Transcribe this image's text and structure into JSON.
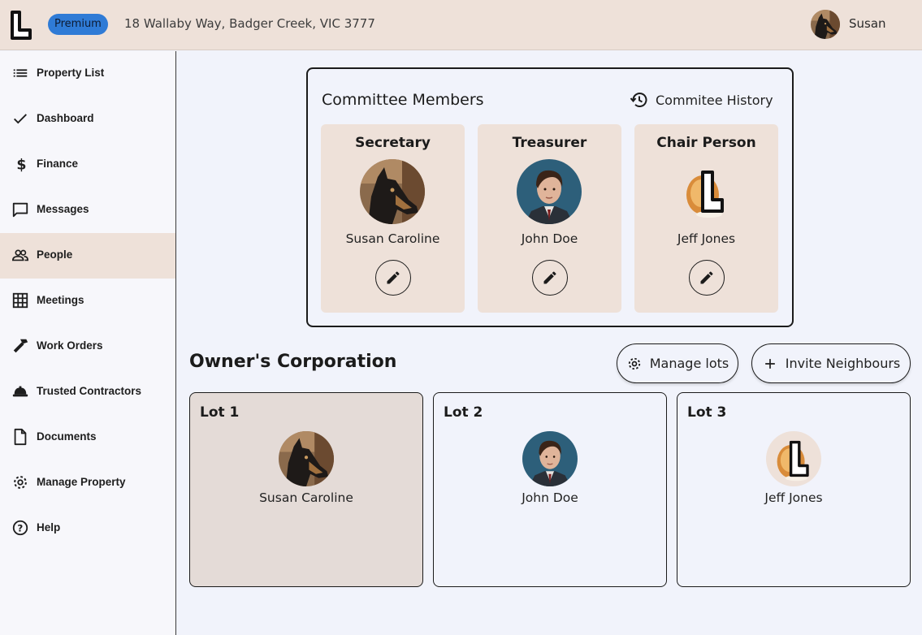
{
  "header": {
    "badge": "Premium",
    "address": "18 Wallaby Way, Badger Creek, VIC 3777",
    "user_name": "Susan"
  },
  "sidebar": {
    "items": [
      {
        "label": "Property List",
        "icon": "list-icon"
      },
      {
        "label": "Dashboard",
        "icon": "check-icon"
      },
      {
        "label": "Finance",
        "icon": "dollar-icon"
      },
      {
        "label": "Messages",
        "icon": "message-icon"
      },
      {
        "label": "People",
        "icon": "people-icon",
        "active": true
      },
      {
        "label": "Meetings",
        "icon": "grid-icon"
      },
      {
        "label": "Work Orders",
        "icon": "hammer-icon"
      },
      {
        "label": "Trusted Contractors",
        "icon": "hardhat-icon"
      },
      {
        "label": "Documents",
        "icon": "document-icon"
      },
      {
        "label": "Manage Property",
        "icon": "gear-icon"
      },
      {
        "label": "Help",
        "icon": "help-icon"
      }
    ]
  },
  "committee": {
    "title": "Committee Members",
    "history_label": "Commitee History",
    "members": [
      {
        "role": "Secretary",
        "name": "Susan Caroline",
        "avatar": "dog-photo"
      },
      {
        "role": "Treasurer",
        "name": "John Doe",
        "avatar": "man-photo"
      },
      {
        "role": "Chair Person",
        "name": "Jeff Jones",
        "avatar": "logo-nut-image"
      }
    ]
  },
  "owners_corporation": {
    "title": "Owner's Corporation",
    "manage_lots_label": "Manage lots",
    "invite_label": "Invite Neighbours",
    "lots": [
      {
        "title": "Lot 1",
        "owner": "Susan Caroline",
        "avatar": "dog-photo",
        "selected": true
      },
      {
        "title": "Lot 2",
        "owner": "John Doe",
        "avatar": "man-photo"
      },
      {
        "title": "Lot 3",
        "owner": "Jeff Jones",
        "avatar": "logo-nut-image"
      }
    ]
  },
  "colors": {
    "header_bg": "#eee1d9",
    "badge_bg": "#2f7bd6",
    "active_nav_bg": "#eee1d9",
    "selected_lot_bg": "#e4dbd7"
  }
}
